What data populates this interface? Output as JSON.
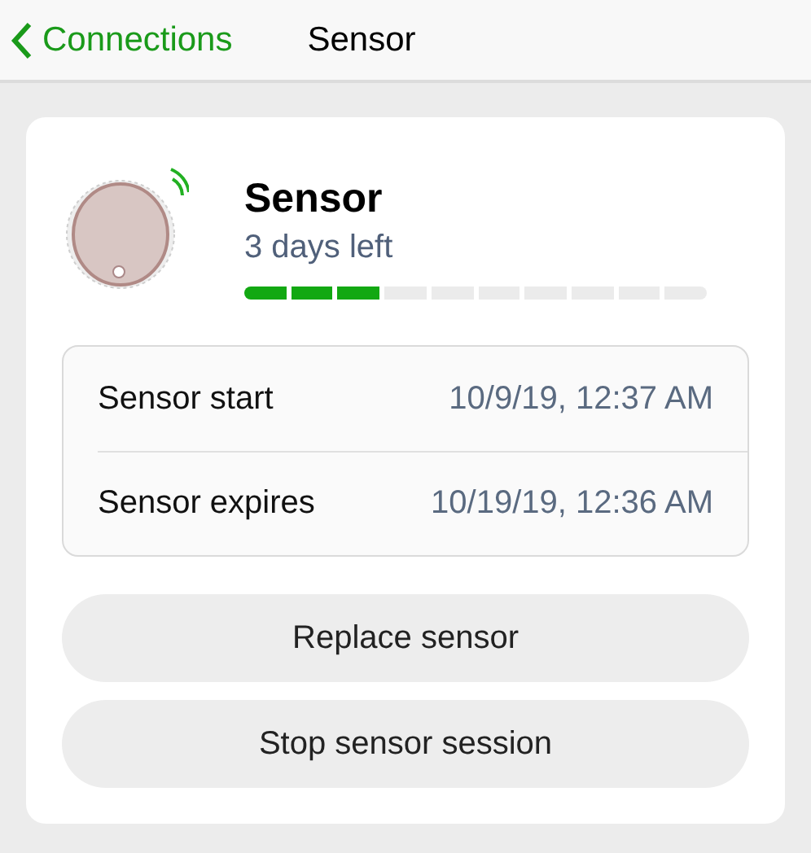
{
  "nav": {
    "back_label": "Connections",
    "title": "Sensor"
  },
  "sensor": {
    "name": "Sensor",
    "remaining": "3 days left",
    "level": 0.3
  },
  "details": [
    {
      "label": "Sensor start",
      "value": "10/9/19, 12:37 AM"
    },
    {
      "label": "Sensor expires",
      "value": "10/19/19, 12:36 AM"
    }
  ],
  "buttons": [
    "Replace sensor",
    "Stop sensor session"
  ]
}
